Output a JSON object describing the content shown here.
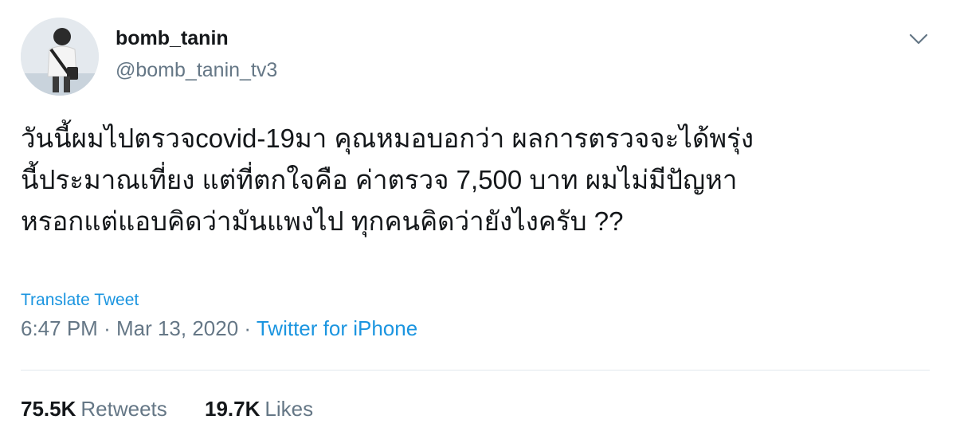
{
  "tweet": {
    "author": {
      "display_name": "bomb_tanin",
      "handle": "@bomb_tanin_tv3"
    },
    "menu_icon": "chevron-down-icon",
    "text_lines": [
      "วันนี้ผมไปตรวจcovid-19มา คุณหมอบอกว่า ผลการตรวจจะได้พรุ่ง",
      "นี้ประมาณเที่ยง แต่ที่ตกใจคือ ค่าตรวจ 7,500 บาท ผมไม่มีปัญหา",
      "หรอกแต่แอบคิดว่ามันแพงไป ทุกคนคิดว่ายังไงครับ ??"
    ],
    "translate_label": "Translate Tweet",
    "time": "6:47 PM",
    "date": "Mar 13, 2020",
    "separator": "·",
    "source": "Twitter for iPhone",
    "stats": {
      "retweets_count": "75.5K",
      "retweets_label": "Retweets",
      "likes_count": "19.7K",
      "likes_label": "Likes"
    }
  },
  "colors": {
    "text": "#14171a",
    "secondary": "#657786",
    "link": "#1b95e0",
    "divider": "#e1e8ed"
  }
}
